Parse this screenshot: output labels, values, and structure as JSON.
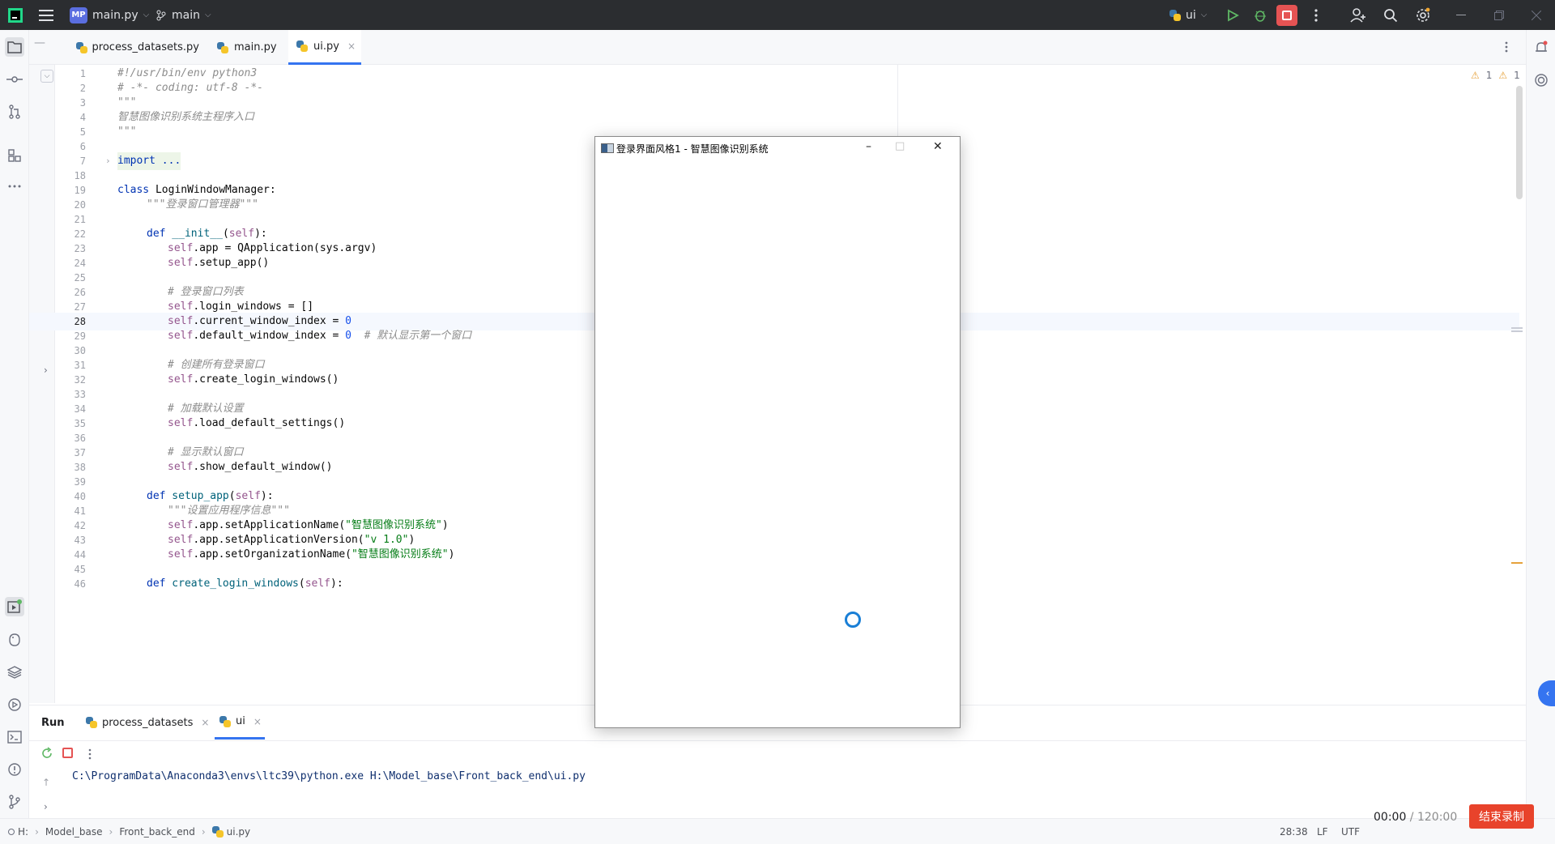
{
  "titlebar": {
    "project_badge": "MP",
    "project_name": "main.py",
    "branch": "main",
    "run_config": "ui"
  },
  "tabs": [
    {
      "label": "process_datasets.py"
    },
    {
      "label": "main.py"
    },
    {
      "label": "ui.py",
      "close": "×"
    }
  ],
  "inspections": {
    "warnings_a": "1",
    "warnings_b": "1"
  },
  "code_lines": [
    {
      "n": "1"
    },
    {
      "n": "2"
    },
    {
      "n": "3"
    },
    {
      "n": "4"
    },
    {
      "n": "5"
    },
    {
      "n": "6"
    },
    {
      "n": "7"
    },
    {
      "n": "18"
    },
    {
      "n": "19"
    },
    {
      "n": "20"
    },
    {
      "n": "21"
    },
    {
      "n": "22"
    },
    {
      "n": "23"
    },
    {
      "n": "24"
    },
    {
      "n": "25"
    },
    {
      "n": "26"
    },
    {
      "n": "27"
    },
    {
      "n": "28"
    },
    {
      "n": "29"
    },
    {
      "n": "30"
    },
    {
      "n": "31"
    },
    {
      "n": "32"
    },
    {
      "n": "33"
    },
    {
      "n": "34"
    },
    {
      "n": "35"
    },
    {
      "n": "36"
    },
    {
      "n": "37"
    },
    {
      "n": "38"
    },
    {
      "n": "39"
    },
    {
      "n": "40"
    },
    {
      "n": "41"
    },
    {
      "n": "42"
    },
    {
      "n": "43"
    },
    {
      "n": "44"
    },
    {
      "n": "45"
    },
    {
      "n": "46"
    }
  ],
  "code": {
    "l1": "#!/usr/bin/env python3",
    "l2": "# -*- coding: utf-8 -*-",
    "l3": "\"\"\"",
    "l4": "智慧图像识别系统主程序入口",
    "l5": "\"\"\"",
    "l7": "import ...",
    "l19_kw": "class",
    "l19_name": " LoginWindowManager:",
    "l20": "\"\"\"登录窗口管理器\"\"\"",
    "l22_kw": "def",
    "l22_fn": " __init__",
    "l22_a": "(",
    "l22_self": "self",
    "l22_b": "):",
    "l23_self": "self",
    "l23_rest": ".app = QApplication(sys.argv)",
    "l24_self": "self",
    "l24_rest": ".setup_app()",
    "l26": "# 登录窗口列表",
    "l27_self": "self",
    "l27_rest": ".login_windows = []",
    "l28_self": "self",
    "l28_rest": ".current_window_index = ",
    "l28_num": "0",
    "l29_self": "self",
    "l29_rest": ".default_window_index = ",
    "l29_num": "0",
    "l29_cmt": "  # 默认显示第一个窗口",
    "l31": "# 创建所有登录窗口",
    "l32_self": "self",
    "l32_rest": ".create_login_windows()",
    "l34": "# 加载默认设置",
    "l35_self": "self",
    "l35_rest": ".load_default_settings()",
    "l37": "# 显示默认窗口",
    "l38_self": "self",
    "l38_rest": ".show_default_window()",
    "l40_kw": "def",
    "l40_fn": " setup_app",
    "l40_a": "(",
    "l40_self": "self",
    "l40_b": "):",
    "l41": "\"\"\"设置应用程序信息\"\"\"",
    "l42_self": "self",
    "l42_rest": ".app.setApplicationName(",
    "l42_str": "\"智慧图像识别系统\"",
    "l42_end": ")",
    "l43_self": "self",
    "l43_rest": ".app.setApplicationVersion(",
    "l43_str": "\"v 1.0\"",
    "l43_end": ")",
    "l44_self": "self",
    "l44_rest": ".app.setOrganizationName(",
    "l44_str": "\"智慧图像识别系统\"",
    "l44_end": ")",
    "l46_kw": "def",
    "l46_fn": " create_login_windows",
    "l46_a": "(",
    "l46_self": "self",
    "l46_b": "):"
  },
  "popup": {
    "title": "登录界面风格1 - 智慧图像识别系统",
    "min": "–",
    "max": "□",
    "close": "✕"
  },
  "run": {
    "title": "Run",
    "tabs": [
      {
        "label": "process_datasets",
        "close": "×"
      },
      {
        "label": "ui",
        "close": "×"
      }
    ],
    "output": "C:\\ProgramData\\Anaconda3\\envs\\ltc39\\python.exe H:\\Model_base\\Front_back_end\\ui.py"
  },
  "status": {
    "drive": "H:",
    "crumb1": "Model_base",
    "crumb2": "Front_back_end",
    "file": "ui.py",
    "position": "28:38",
    "line_sep": "LF",
    "encoding": "UTF"
  },
  "recording": {
    "elapsed": "00:00",
    "total": " / 120:00",
    "stop_label": "结束录制"
  }
}
